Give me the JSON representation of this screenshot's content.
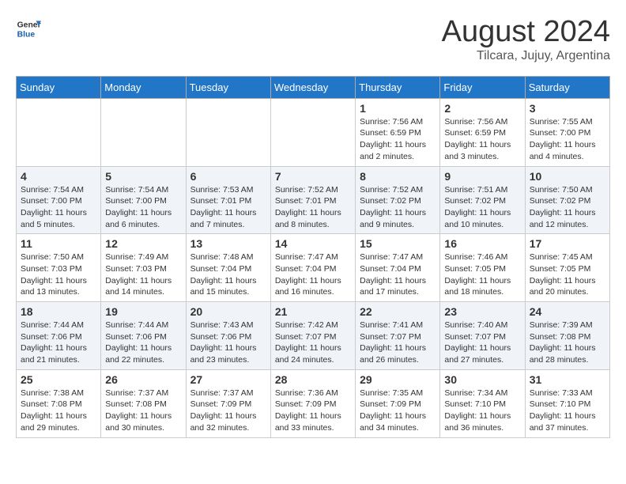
{
  "logo": {
    "line1": "General",
    "line2": "Blue"
  },
  "title": "August 2024",
  "subtitle": "Tilcara, Jujuy, Argentina",
  "days_of_week": [
    "Sunday",
    "Monday",
    "Tuesday",
    "Wednesday",
    "Thursday",
    "Friday",
    "Saturday"
  ],
  "weeks": [
    [
      {
        "day": "",
        "info": ""
      },
      {
        "day": "",
        "info": ""
      },
      {
        "day": "",
        "info": ""
      },
      {
        "day": "",
        "info": ""
      },
      {
        "day": "1",
        "info": "Sunrise: 7:56 AM\nSunset: 6:59 PM\nDaylight: 11 hours\nand 2 minutes."
      },
      {
        "day": "2",
        "info": "Sunrise: 7:56 AM\nSunset: 6:59 PM\nDaylight: 11 hours\nand 3 minutes."
      },
      {
        "day": "3",
        "info": "Sunrise: 7:55 AM\nSunset: 7:00 PM\nDaylight: 11 hours\nand 4 minutes."
      }
    ],
    [
      {
        "day": "4",
        "info": "Sunrise: 7:54 AM\nSunset: 7:00 PM\nDaylight: 11 hours\nand 5 minutes."
      },
      {
        "day": "5",
        "info": "Sunrise: 7:54 AM\nSunset: 7:00 PM\nDaylight: 11 hours\nand 6 minutes."
      },
      {
        "day": "6",
        "info": "Sunrise: 7:53 AM\nSunset: 7:01 PM\nDaylight: 11 hours\nand 7 minutes."
      },
      {
        "day": "7",
        "info": "Sunrise: 7:52 AM\nSunset: 7:01 PM\nDaylight: 11 hours\nand 8 minutes."
      },
      {
        "day": "8",
        "info": "Sunrise: 7:52 AM\nSunset: 7:02 PM\nDaylight: 11 hours\nand 9 minutes."
      },
      {
        "day": "9",
        "info": "Sunrise: 7:51 AM\nSunset: 7:02 PM\nDaylight: 11 hours\nand 10 minutes."
      },
      {
        "day": "10",
        "info": "Sunrise: 7:50 AM\nSunset: 7:02 PM\nDaylight: 11 hours\nand 12 minutes."
      }
    ],
    [
      {
        "day": "11",
        "info": "Sunrise: 7:50 AM\nSunset: 7:03 PM\nDaylight: 11 hours\nand 13 minutes."
      },
      {
        "day": "12",
        "info": "Sunrise: 7:49 AM\nSunset: 7:03 PM\nDaylight: 11 hours\nand 14 minutes."
      },
      {
        "day": "13",
        "info": "Sunrise: 7:48 AM\nSunset: 7:04 PM\nDaylight: 11 hours\nand 15 minutes."
      },
      {
        "day": "14",
        "info": "Sunrise: 7:47 AM\nSunset: 7:04 PM\nDaylight: 11 hours\nand 16 minutes."
      },
      {
        "day": "15",
        "info": "Sunrise: 7:47 AM\nSunset: 7:04 PM\nDaylight: 11 hours\nand 17 minutes."
      },
      {
        "day": "16",
        "info": "Sunrise: 7:46 AM\nSunset: 7:05 PM\nDaylight: 11 hours\nand 18 minutes."
      },
      {
        "day": "17",
        "info": "Sunrise: 7:45 AM\nSunset: 7:05 PM\nDaylight: 11 hours\nand 20 minutes."
      }
    ],
    [
      {
        "day": "18",
        "info": "Sunrise: 7:44 AM\nSunset: 7:06 PM\nDaylight: 11 hours\nand 21 minutes."
      },
      {
        "day": "19",
        "info": "Sunrise: 7:44 AM\nSunset: 7:06 PM\nDaylight: 11 hours\nand 22 minutes."
      },
      {
        "day": "20",
        "info": "Sunrise: 7:43 AM\nSunset: 7:06 PM\nDaylight: 11 hours\nand 23 minutes."
      },
      {
        "day": "21",
        "info": "Sunrise: 7:42 AM\nSunset: 7:07 PM\nDaylight: 11 hours\nand 24 minutes."
      },
      {
        "day": "22",
        "info": "Sunrise: 7:41 AM\nSunset: 7:07 PM\nDaylight: 11 hours\nand 26 minutes."
      },
      {
        "day": "23",
        "info": "Sunrise: 7:40 AM\nSunset: 7:07 PM\nDaylight: 11 hours\nand 27 minutes."
      },
      {
        "day": "24",
        "info": "Sunrise: 7:39 AM\nSunset: 7:08 PM\nDaylight: 11 hours\nand 28 minutes."
      }
    ],
    [
      {
        "day": "25",
        "info": "Sunrise: 7:38 AM\nSunset: 7:08 PM\nDaylight: 11 hours\nand 29 minutes."
      },
      {
        "day": "26",
        "info": "Sunrise: 7:37 AM\nSunset: 7:08 PM\nDaylight: 11 hours\nand 30 minutes."
      },
      {
        "day": "27",
        "info": "Sunrise: 7:37 AM\nSunset: 7:09 PM\nDaylight: 11 hours\nand 32 minutes."
      },
      {
        "day": "28",
        "info": "Sunrise: 7:36 AM\nSunset: 7:09 PM\nDaylight: 11 hours\nand 33 minutes."
      },
      {
        "day": "29",
        "info": "Sunrise: 7:35 AM\nSunset: 7:09 PM\nDaylight: 11 hours\nand 34 minutes."
      },
      {
        "day": "30",
        "info": "Sunrise: 7:34 AM\nSunset: 7:10 PM\nDaylight: 11 hours\nand 36 minutes."
      },
      {
        "day": "31",
        "info": "Sunrise: 7:33 AM\nSunset: 7:10 PM\nDaylight: 11 hours\nand 37 minutes."
      }
    ]
  ]
}
